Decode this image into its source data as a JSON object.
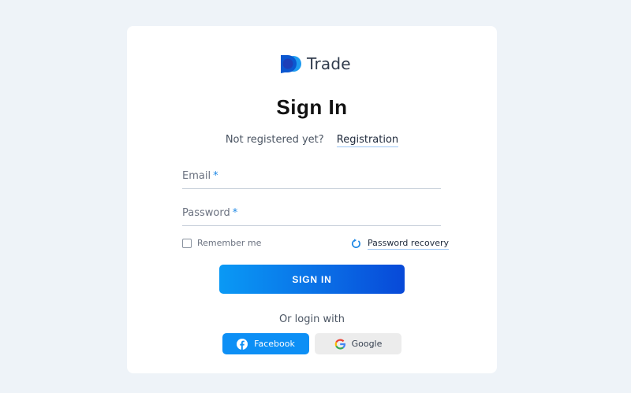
{
  "brand": {
    "name": "Trade",
    "primary_color": "#0a6fe6",
    "accent_color": "#1e88e5"
  },
  "page": {
    "title": "Sign In"
  },
  "register": {
    "prompt": "Not registered yet?",
    "link_label": "Registration"
  },
  "form": {
    "email": {
      "label": "Email",
      "required_mark": "*",
      "value": ""
    },
    "password": {
      "label": "Password",
      "required_mark": "*",
      "value": ""
    },
    "remember": {
      "label": "Remember me",
      "checked": false
    },
    "recovery": {
      "label": "Password recovery",
      "icon": "refresh-icon"
    },
    "submit_label": "SIGN IN"
  },
  "social": {
    "prompt": "Or login with",
    "facebook": {
      "label": "Facebook",
      "icon": "facebook-icon",
      "color": "#0d8ff5"
    },
    "google": {
      "label": "Google",
      "icon": "google-icon",
      "color": "#ececec"
    }
  }
}
